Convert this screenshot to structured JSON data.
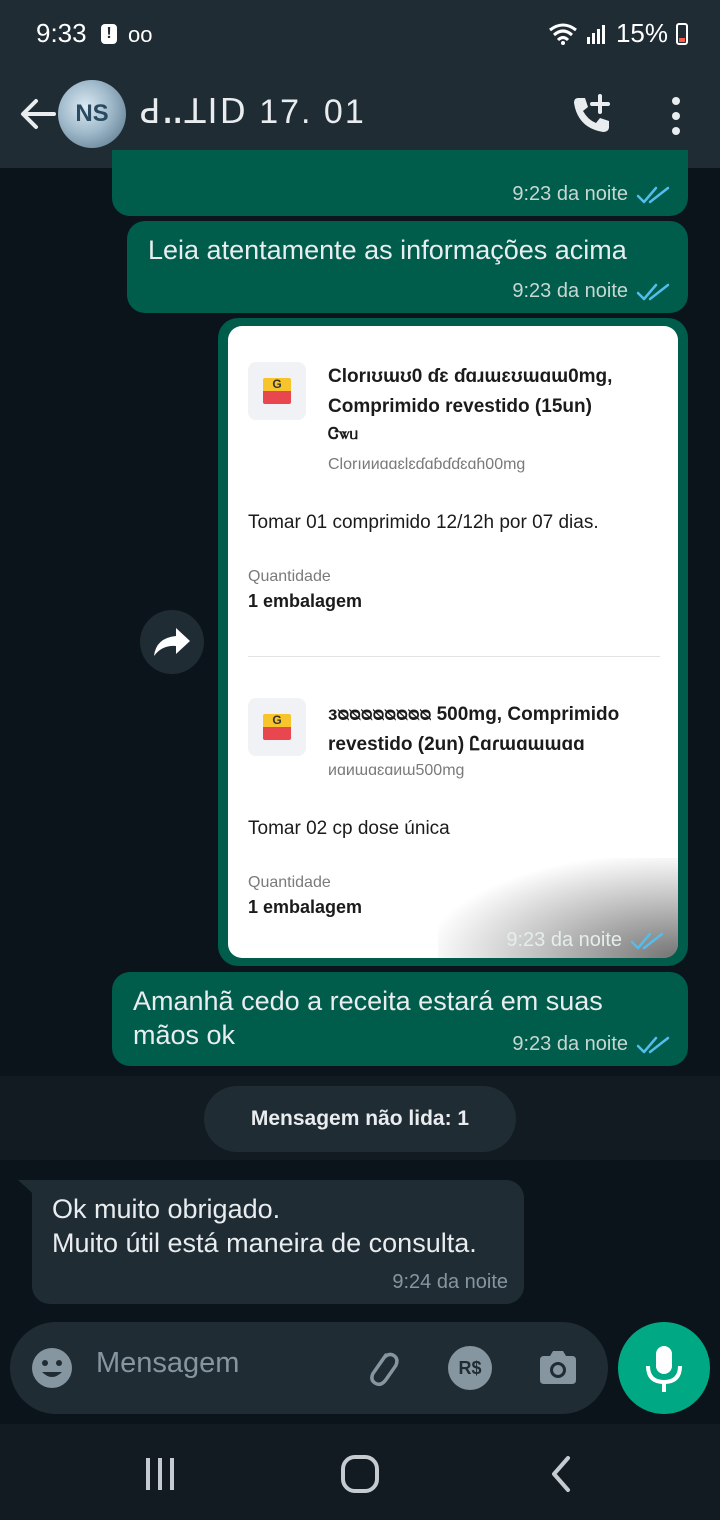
{
  "status_bar": {
    "time": "9:33",
    "alert_glyph": "!",
    "voicemail_glyph": "oo",
    "battery": "15%"
  },
  "header": {
    "avatar_text": "NS",
    "contact_name": "ꓒꓺꓕꓲꓓ 17. 01"
  },
  "messages": [
    {
      "type": "outgoing",
      "text": "",
      "time": "9:23 da noite"
    },
    {
      "type": "outgoing",
      "text": "Leia atentamente as informações  acima",
      "time": "9:23 da noite"
    },
    {
      "type": "outgoing-card",
      "time": "9:23 da noite",
      "products": [
        {
          "icon_letter": "G",
          "name_line1": "Clorıʊɯʊ0 ɗɛ ɗɑɹɯɛʊɯɑɯ0mg,",
          "name_line2": "Comprimido revestido (15un)",
          "name_line3": "Ꮳꮤᥙ",
          "sub": "Clorıᴎᴎɑɑɛlɛɗɑɓɗɗɛɑɦ00mg",
          "dosage": "Tomar 01 comprimido 12/12h por 07 dias.",
          "qty_label": "Quantidade",
          "qty_value": "1 embalagem"
        },
        {
          "icon_letter": "G",
          "name_line1": "ᴈᴓᴓᴓᴓᴓᴓᴓᴓ 500mg, Comprimido",
          "name_line2": "revestido (2un) Ꮭɑɾɯɑɯɯɑɑ",
          "sub": "ᴎɑᴎɯɑɛɑᴎɯ500mg",
          "dosage": "Tomar 02 cp dose única",
          "qty_label": "Quantidade",
          "qty_value": "1 embalagem"
        }
      ]
    },
    {
      "type": "outgoing",
      "text_line1": "Amanhã cedo a receita estará em suas",
      "text_line2": "mãos ok",
      "time": "9:23 da noite"
    },
    {
      "type": "incoming",
      "text_line1": "Ok muito obrigado.",
      "text_line2": "Muito útil está maneira de consulta.",
      "time": "9:24 da noite"
    }
  ],
  "unread": {
    "label": "Mensagem não lida: 1"
  },
  "input": {
    "placeholder": "Mensagem",
    "currency_label": "R$"
  },
  "colors": {
    "outgoing_bubble": "#005c4b",
    "incoming_bubble": "#1f2c34",
    "read_ticks": "#53bdeb",
    "mic_button": "#00a884",
    "background": "#0b141a"
  },
  "icons": [
    "arrow-left-icon",
    "call-add-icon",
    "more-vert-icon",
    "forward-icon",
    "emoji-icon",
    "attach-icon",
    "payment-icon",
    "camera-icon",
    "mic-icon",
    "recents-icon",
    "home-icon",
    "back-nav-icon",
    "double-check-icon"
  ]
}
